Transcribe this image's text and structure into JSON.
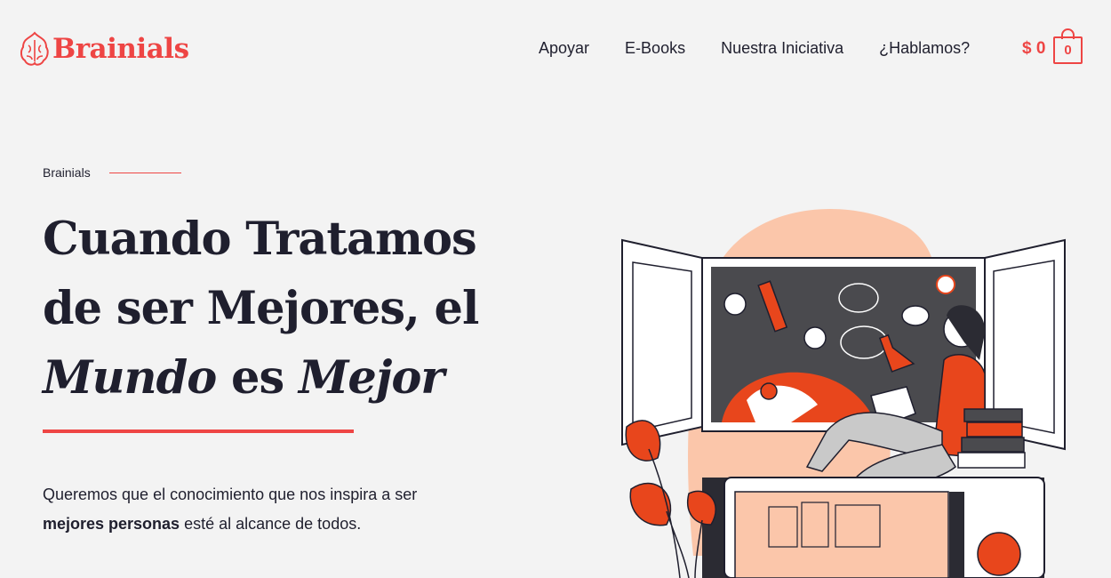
{
  "brand": {
    "name": "Brainials",
    "accent": "#ee4544"
  },
  "nav": [
    {
      "label": "Apoyar"
    },
    {
      "label": "E-Books"
    },
    {
      "label": "Nuestra Iniciativa"
    },
    {
      "label": "¿Hablamos?"
    }
  ],
  "cart": {
    "total": "$ 0",
    "count": "0"
  },
  "hero": {
    "eyebrow": "Brainials",
    "headline_line1": "Cuando Tratamos",
    "headline_line2": "de ser Mejores, el",
    "headline_word1": "Mundo",
    "headline_word2": " es ",
    "headline_word3": "Mejor",
    "intro_text": "Queremos que el conocimiento que nos inspira a ser",
    "intro_bold": "mejores personas",
    "intro_tail": " esté al alcance de todos."
  }
}
